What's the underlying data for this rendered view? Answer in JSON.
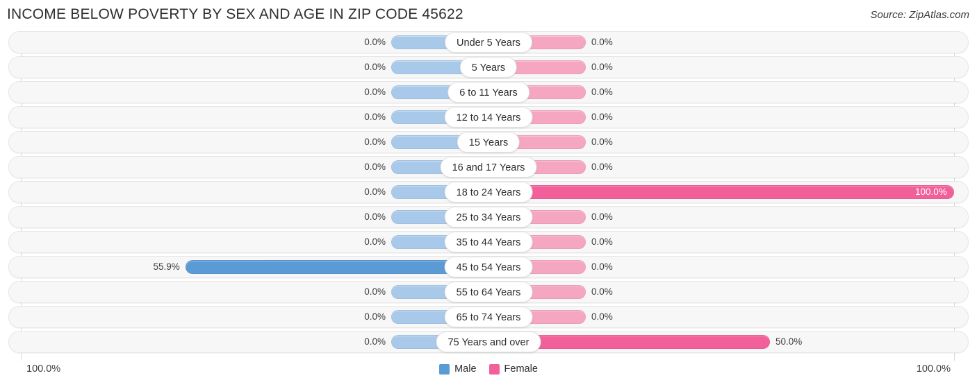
{
  "header": {
    "title": "INCOME BELOW POVERTY BY SEX AND AGE IN ZIP CODE 45622",
    "source": "Source: ZipAtlas.com"
  },
  "footer": {
    "left_axis_label": "100.0%",
    "right_axis_label": "100.0%"
  },
  "legend": {
    "items": [
      {
        "label": "Male",
        "color": "#5b9bd5"
      },
      {
        "label": "Female",
        "color": "#f2609a"
      }
    ]
  },
  "colors": {
    "male_light": "#a9c9ea",
    "male_strong": "#5b9bd5",
    "female_light": "#f5a6c0",
    "female_strong": "#f2609a",
    "track": "#f7f7f7",
    "axis": "#d8d8d8"
  },
  "chart_data": {
    "type": "bar",
    "title": "INCOME BELOW POVERTY BY SEX AND AGE IN ZIP CODE 45622",
    "subtitle": "Source: ZipAtlas.com",
    "orientation": "horizontal-diverging",
    "xlabel": "",
    "ylabel": "",
    "xlim": [
      100.0,
      100.0
    ],
    "axis_tick_labels": [
      "100.0%",
      "100.0%"
    ],
    "grid": false,
    "legend_position": "bottom-center",
    "categories": [
      "Under 5 Years",
      "5 Years",
      "6 to 11 Years",
      "12 to 14 Years",
      "15 Years",
      "16 and 17 Years",
      "18 to 24 Years",
      "25 to 34 Years",
      "35 to 44 Years",
      "45 to 54 Years",
      "55 to 64 Years",
      "65 to 74 Years",
      "75 Years and over"
    ],
    "series": [
      {
        "name": "Male",
        "values": [
          0.0,
          0.0,
          0.0,
          0.0,
          0.0,
          0.0,
          0.0,
          0.0,
          0.0,
          55.9,
          0.0,
          0.0,
          0.0
        ],
        "labels": [
          "0.0%",
          "0.0%",
          "0.0%",
          "0.0%",
          "0.0%",
          "0.0%",
          "0.0%",
          "0.0%",
          "0.0%",
          "55.9%",
          "0.0%",
          "0.0%",
          "0.0%"
        ]
      },
      {
        "name": "Female",
        "values": [
          0.0,
          0.0,
          0.0,
          0.0,
          0.0,
          0.0,
          100.0,
          0.0,
          0.0,
          0.0,
          0.0,
          0.0,
          50.0
        ],
        "labels": [
          "0.0%",
          "0.0%",
          "0.0%",
          "0.0%",
          "0.0%",
          "0.0%",
          "100.0%",
          "0.0%",
          "0.0%",
          "0.0%",
          "0.0%",
          "0.0%",
          "50.0%"
        ]
      }
    ]
  }
}
